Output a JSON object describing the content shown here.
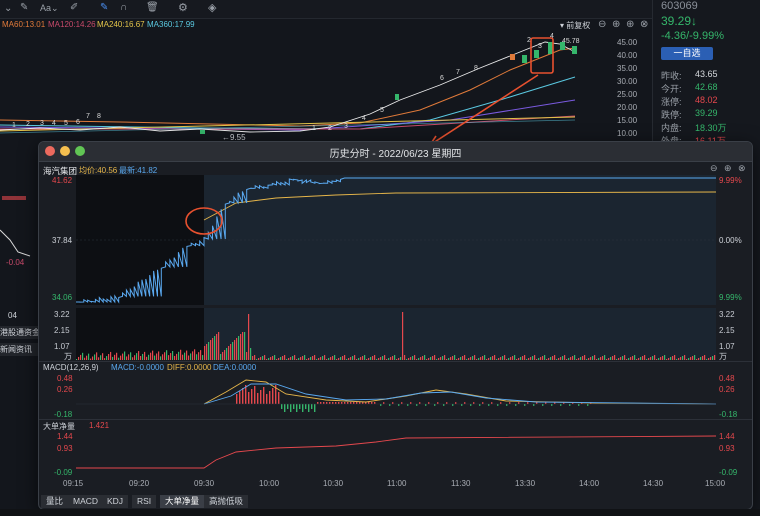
{
  "top_toolbar": {
    "ma_labels": [
      {
        "text": "MA60:13.01",
        "color": "#e07a3a"
      },
      {
        "text": "MA120:14.26",
        "color": "#c74a6a"
      },
      {
        "text": "MA240:16.67",
        "color": "#e2c34a"
      },
      {
        "text": "MA360:17.99",
        "color": "#5ac8e0"
      }
    ],
    "fuquan_label": "前复权",
    "price_axis": [
      "45.00",
      "40.00",
      "35.00",
      "30.00",
      "25.00",
      "20.00",
      "15.00",
      "10.00"
    ],
    "low_marker": "9.55",
    "left_labels": {
      "minus": "-0.04",
      "date": "04",
      "hk_link": "港股通资金",
      "news": "新闻资讯"
    },
    "wave_numbers": [
      "1",
      "2",
      "3",
      "4",
      "5",
      "6",
      "7",
      "8"
    ],
    "peak_label": "45.78"
  },
  "quote_panel": {
    "code": "603069",
    "price": "39.29↓",
    "change": "-4.36/-9.99%",
    "watch_button": "一自选",
    "rows": [
      {
        "label": "昨收:",
        "value": "43.65",
        "color": "#d5d8dc"
      },
      {
        "label": "今开:",
        "value": "42.68",
        "color": "#35b66b"
      },
      {
        "label": "涨停:",
        "value": "48.02",
        "color": "#e5484d"
      },
      {
        "label": "跌停:",
        "value": "39.29",
        "color": "#35b66b"
      },
      {
        "label": "内盘:",
        "value": "18.30万",
        "color": "#35b66b"
      },
      {
        "label": "外盘:",
        "value": "16.11万",
        "color": "#e5484d"
      }
    ]
  },
  "popup": {
    "title": "历史分时 - 2022/06/23 星期四",
    "stock_name": "海汽集团",
    "avg_label": "均价:40.56",
    "last_label": "最新:41.82",
    "price_ticks_left": [
      "41.62",
      "37.84",
      "34.06"
    ],
    "price_ticks_right": [
      "9.99%",
      "0.00%",
      "9.99%"
    ],
    "vol_ticks_left": [
      "3.22",
      "2.15",
      "1.07",
      "万"
    ],
    "vol_ticks_right": [
      "3.22",
      "2.15",
      "1.07",
      "万"
    ],
    "macd": {
      "title": "MACD(12,26,9)",
      "macd": "MACD:-0.0000",
      "diff": "DIFF:0.0000",
      "dea": "DEA:0.0000",
      "ticks_left": [
        "0.48",
        "0.26",
        "-0.18"
      ],
      "ticks_right": [
        "0.48",
        "0.26",
        "-0.18"
      ]
    },
    "bigorder": {
      "title": "大单净量",
      "value": "1.421",
      "ticks_left": [
        "1.44",
        "0.93",
        "-0.09"
      ],
      "ticks_right": [
        "1.44",
        "0.93",
        "-0.09"
      ]
    },
    "time_axis": [
      "09:15",
      "09:20",
      "09:30",
      "10:00",
      "10:30",
      "11:00",
      "11:30",
      "13:30",
      "14:00",
      "14:30",
      "15:00"
    ],
    "tabs": [
      "量比",
      "MACD",
      "KDJ",
      "RSI",
      "大单净量",
      "高抛低吸"
    ],
    "active_tab": "大单净量"
  },
  "price_line": [
    {
      "t": "09:15",
      "p": 34.06
    },
    {
      "t": "09:20",
      "p": 34.4
    },
    {
      "t": "09:25",
      "p": 36.2
    },
    {
      "t": "09:28",
      "p": 37.5
    },
    {
      "t": "09:30",
      "p": 37.9
    },
    {
      "t": "09:40",
      "p": 40.1
    },
    {
      "t": "09:50",
      "p": 41.0
    },
    {
      "t": "10:00",
      "p": 41.2
    },
    {
      "t": "10:10",
      "p": 41.5
    },
    {
      "t": "10:20",
      "p": 41.3
    },
    {
      "t": "10:30",
      "p": 41.4
    },
    {
      "t": "10:34",
      "p": 41.62
    },
    {
      "t": "15:00",
      "p": 41.62
    }
  ]
}
